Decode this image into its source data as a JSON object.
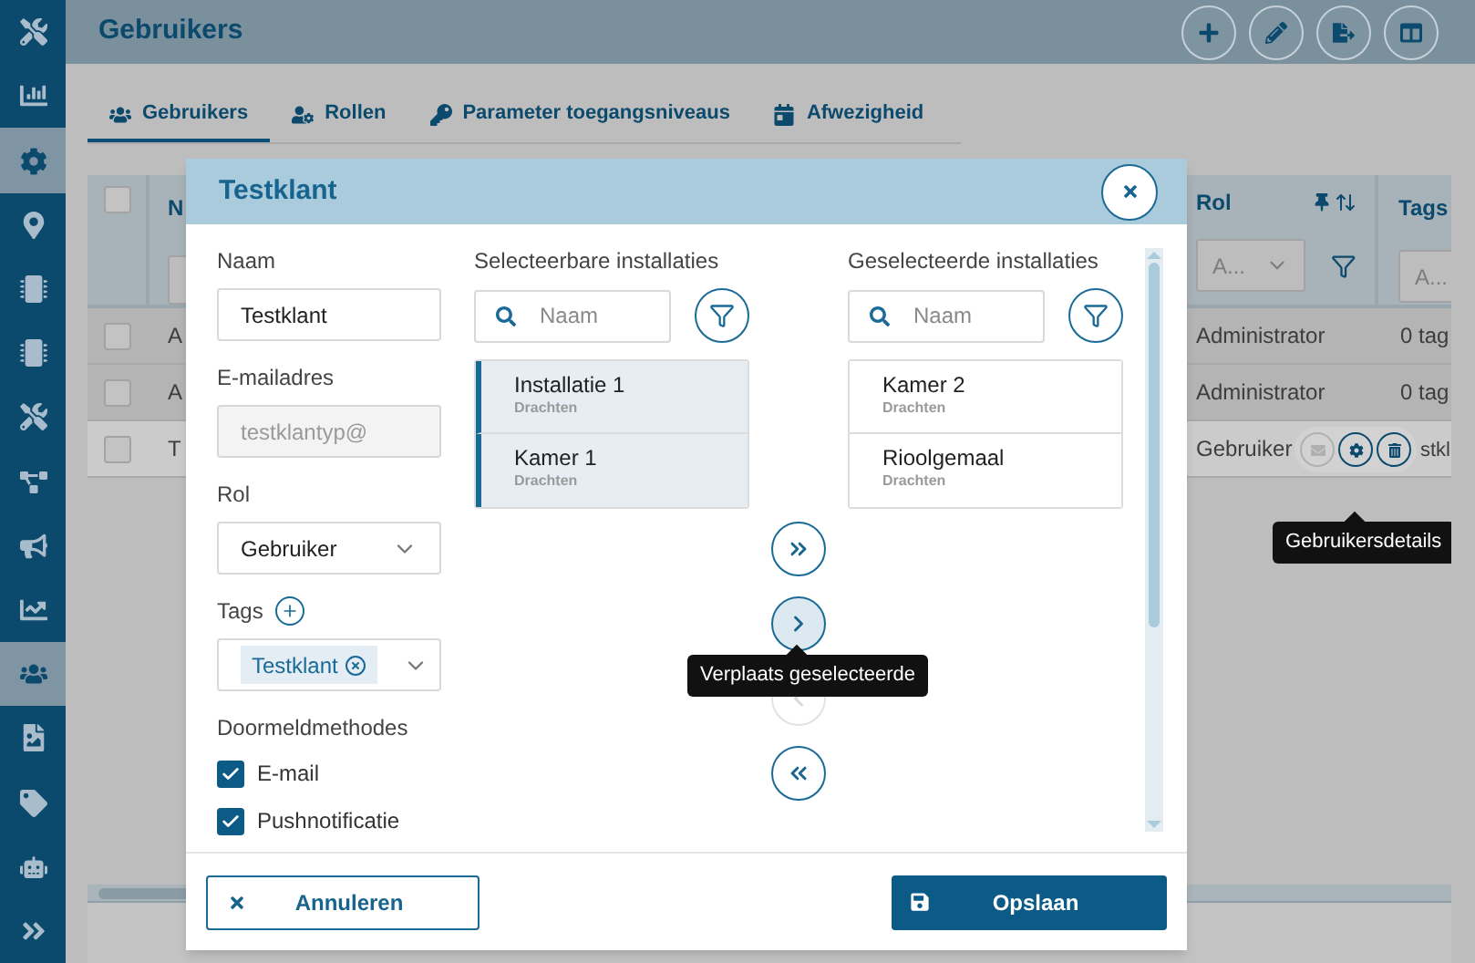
{
  "header": {
    "title": "Gebruikers"
  },
  "sidebar": {
    "items": [
      {
        "selected": false
      },
      {
        "selected": false
      },
      {
        "selected": true
      },
      {
        "selected": false
      },
      {
        "selected": false
      },
      {
        "selected": false
      },
      {
        "selected": false
      },
      {
        "selected": false
      },
      {
        "selected": false
      },
      {
        "selected": false
      },
      {
        "selected": true
      },
      {
        "selected": false
      },
      {
        "selected": false
      },
      {
        "selected": false
      },
      {
        "selected": false
      }
    ]
  },
  "tabs": [
    {
      "label": "Gebruikers",
      "selected": true
    },
    {
      "label": "Rollen",
      "selected": false
    },
    {
      "label": "Parameter toegangsniveaus",
      "selected": false
    },
    {
      "label": "Afwezigheid",
      "selected": false
    }
  ],
  "table": {
    "all_checked": false,
    "columns": [
      {
        "label": "N"
      },
      {
        "label": "Rol",
        "filter": "A..."
      },
      {
        "label": "Tags",
        "filter": "A..."
      }
    ],
    "rows": [
      {
        "cells": [
          "A",
          "Administrator",
          "0 tag"
        ],
        "hovered": false,
        "checked": false
      },
      {
        "cells": [
          "A",
          "Administrator",
          "0 tag"
        ],
        "hovered": false,
        "checked": false
      },
      {
        "cells": [
          "T",
          "Gebruiker",
          "stkl"
        ],
        "hovered": true,
        "checked": false,
        "actions": [
          {
            "kind": "mail",
            "disabled": true
          },
          {
            "kind": "details",
            "disabled": false
          },
          {
            "kind": "delete",
            "disabled": false
          }
        ]
      }
    ],
    "tooltip": "Gebruikersdetails"
  },
  "dialog": {
    "title": "Testklant",
    "fields": [
      {
        "kind": "text",
        "label": "Naam",
        "value": "Testklant",
        "disabled": false
      },
      {
        "kind": "text",
        "label": "E-mailadres",
        "value": "testklantyp@",
        "disabled": true
      },
      {
        "kind": "select",
        "label": "Rol",
        "value": "Gebruiker"
      },
      {
        "kind": "tags",
        "label": "Tags",
        "tags": [
          "Testklant"
        ]
      },
      {
        "kind": "checkboxes",
        "label": "Doormeldmethodes",
        "options": [
          {
            "label": "E-mail",
            "checked": true
          },
          {
            "label": "Pushnotificatie",
            "checked": true
          }
        ]
      }
    ],
    "available": {
      "title": "Selecteerbare installaties",
      "search": {
        "placeholder": "Naam"
      },
      "items": [
        {
          "name": "Installatie 1",
          "location": "Drachten",
          "selected": true
        },
        {
          "name": "Kamer 1",
          "location": "Drachten",
          "selected": true
        }
      ]
    },
    "transfer_buttons": [
      {
        "kind": "all-right",
        "disabled": false,
        "hovered": false
      },
      {
        "kind": "right",
        "disabled": false,
        "hovered": true
      },
      {
        "kind": "left",
        "disabled": true,
        "hovered": false
      },
      {
        "kind": "all-left",
        "disabled": false,
        "hovered": false
      }
    ],
    "tooltip": "Verplaats geselecteerde",
    "chosen": {
      "title": "Geselecteerde installaties",
      "search": {
        "placeholder": "Naam"
      },
      "items": [
        {
          "name": "Kamer 2",
          "location": "Drachten",
          "selected": false
        },
        {
          "name": "Rioolgemaal",
          "location": "Drachten",
          "selected": false
        }
      ]
    },
    "buttons": [
      {
        "kind": "cancel",
        "label": "Annuleren"
      },
      {
        "kind": "save",
        "label": "Opslaan"
      }
    ]
  }
}
